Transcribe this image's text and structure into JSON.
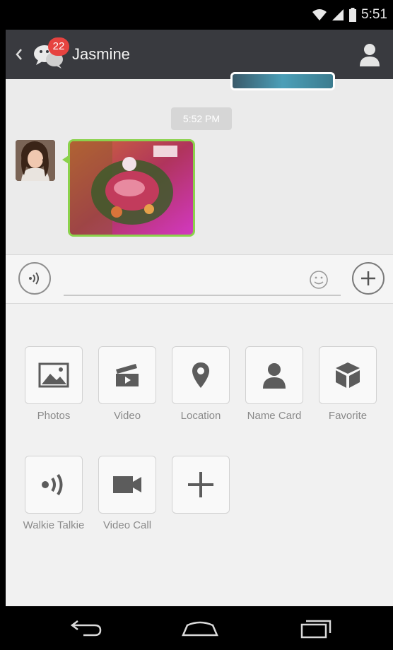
{
  "status_bar": {
    "time": "5:51",
    "icons": [
      "wifi-icon",
      "signal-icon",
      "battery-icon"
    ]
  },
  "header": {
    "back_icon": "chevron-left-icon",
    "app_icon": "wechat-logo-icon",
    "unread_count": "22",
    "title": "Jasmine",
    "profile_icon": "person-icon"
  },
  "chat": {
    "timestamp": "5:52 PM",
    "messages": [
      {
        "sender": "contact",
        "type": "image",
        "avatar_icon": "contact-avatar"
      }
    ]
  },
  "input": {
    "voice_icon": "voice-mode-icon",
    "text_value": "",
    "emoji_icon": "emoji-icon",
    "more_icon": "plus-icon"
  },
  "panel": {
    "items": [
      {
        "label": "Photos",
        "icon": "photos-icon"
      },
      {
        "label": "Video",
        "icon": "video-clapper-icon"
      },
      {
        "label": "Location",
        "icon": "location-pin-icon"
      },
      {
        "label": "Name Card",
        "icon": "person-icon"
      },
      {
        "label": "Favorite",
        "icon": "cube-icon"
      },
      {
        "label": "Walkie Talkie",
        "icon": "walkie-talkie-icon"
      },
      {
        "label": "Video Call",
        "icon": "video-camera-icon"
      },
      {
        "label": "",
        "icon": "add-icon"
      }
    ]
  },
  "nav": {
    "icons": [
      "back-icon",
      "home-icon",
      "recents-icon"
    ]
  },
  "colors": {
    "action_bar": "#393a3f",
    "bubble_border": "#8bd24c",
    "badge": "#e64340",
    "icon_gray": "#5c5c5c"
  }
}
